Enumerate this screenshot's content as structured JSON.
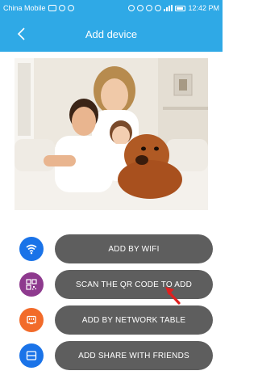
{
  "status_bar": {
    "carrier": "China Mobile",
    "time": "12:42 PM"
  },
  "header": {
    "title": "Add device",
    "back_icon": "chevron-left-icon"
  },
  "options": [
    {
      "label": "ADD BY WIFI",
      "icon": "wifi-icon",
      "icon_color": "#1a73e8"
    },
    {
      "label": "SCAN THE QR CODE TO ADD",
      "icon": "qr-code-icon",
      "icon_color": "#8e3a8e"
    },
    {
      "label": "ADD BY NETWORK TABLE",
      "icon": "network-port-icon",
      "icon_color": "#f26b2a"
    },
    {
      "label": "ADD SHARE WITH FRIENDS",
      "icon": "share-device-icon",
      "icon_color": "#1a73e8"
    }
  ],
  "colors": {
    "accent": "#2fa9e6",
    "button_bg": "#5e5e5e",
    "pointer_arrow": "#e0201f"
  }
}
